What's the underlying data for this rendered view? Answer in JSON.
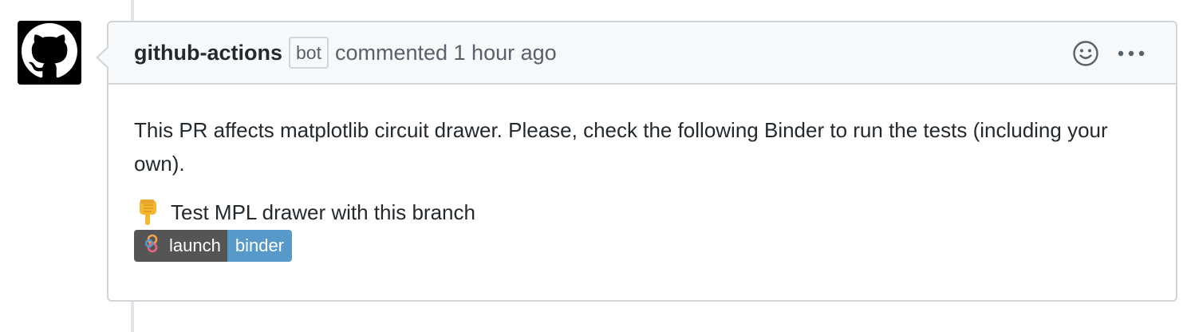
{
  "comment": {
    "author": "github-actions",
    "author_badge": "bot",
    "meta": "commented 1 hour ago",
    "body_paragraph": "This PR affects matplotlib circuit drawer. Please, check the following Binder to run the tests (including your own).",
    "cta_text": "Test MPL drawer with this branch",
    "badge": {
      "left_label": "launch",
      "right_label": "binder"
    }
  },
  "icons": {
    "avatar": "github-octocat-icon",
    "reaction": "smiley-icon",
    "more": "kebab-horizontal-icon",
    "pointing": "backhand-index-pointing-down-emoji",
    "badge_logo": "binder-logo-icon"
  },
  "colors": {
    "header_bg": "#f6f8fa",
    "border": "#d1d5da",
    "badge_left": "#555555",
    "badge_right": "#579aca"
  }
}
